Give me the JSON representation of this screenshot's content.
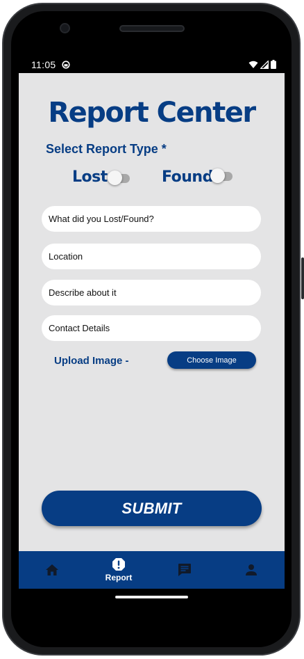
{
  "status_bar": {
    "time": "11:05",
    "icons": [
      "app-notification-icon",
      "wifi-icon",
      "signal-icon",
      "battery-icon"
    ]
  },
  "page": {
    "title": "Report Center",
    "select_type_label": "Select Report Type *"
  },
  "toggles": [
    {
      "label": "Lost",
      "checked": false
    },
    {
      "label": "Found",
      "checked": false
    }
  ],
  "form": {
    "what_placeholder": "What did you Lost/Found?",
    "location_placeholder": "Location",
    "describe_placeholder": "Describe about it",
    "contact_placeholder": "Contact Details",
    "upload_label": "Upload Image -",
    "choose_image_label": "Choose Image",
    "submit_label": "SUBMIT"
  },
  "bottom_nav": {
    "items": [
      {
        "icon": "home-icon",
        "label": ""
      },
      {
        "icon": "report-alert-icon",
        "label": "Report",
        "active": true
      },
      {
        "icon": "chat-icon",
        "label": ""
      },
      {
        "icon": "person-icon",
        "label": ""
      }
    ]
  },
  "colors": {
    "primary": "#073d84",
    "screen_background": "#e4e4e5",
    "field_background": "#ffffff",
    "switch_off_track": "#a8a8a8"
  }
}
